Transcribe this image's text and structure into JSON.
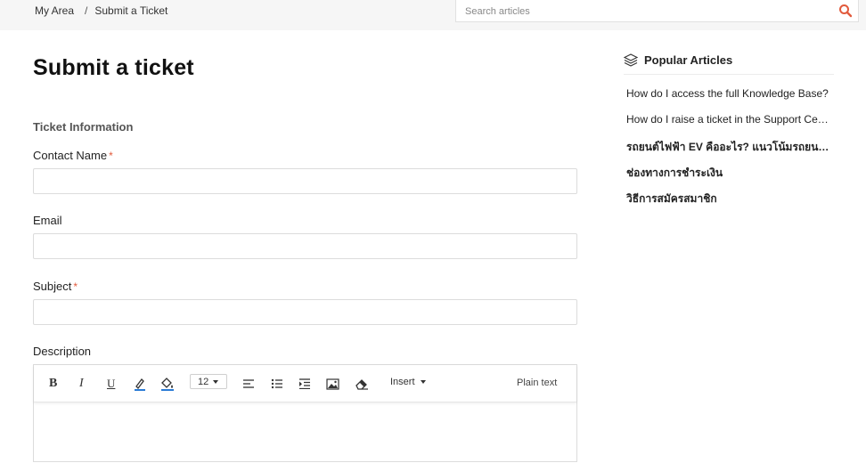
{
  "breadcrumb": {
    "items": [
      "My Area",
      "Submit a Ticket"
    ],
    "separator": "/"
  },
  "search": {
    "placeholder": "Search articles",
    "value": "",
    "icon": "search-icon"
  },
  "form": {
    "title": "Submit a ticket",
    "section_title": "Ticket Information",
    "fields": {
      "contact_name": {
        "label": "Contact Name",
        "required_mark": "*",
        "value": ""
      },
      "email": {
        "label": "Email",
        "value": ""
      },
      "subject": {
        "label": "Subject",
        "required_mark": "*",
        "value": ""
      },
      "description": {
        "label": "Description"
      }
    },
    "editor": {
      "bold": "B",
      "italic": "I",
      "underline": "U",
      "font_size": "12",
      "insert_label": "Insert",
      "plain_text_label": "Plain text"
    }
  },
  "sidebar": {
    "title": "Popular Articles",
    "icon": "layers-icon",
    "articles": [
      "How do I access the full Knowledge Base?",
      "How do I raise a ticket in the Support Center?",
      "รถยนต์ไฟฟ้า EV คืออะไร? แนวโน้มรถยนต์พลังงานไฟฟ้า",
      "ช่องทางการชำระเงิน",
      "วิธีการสมัครสมาชิก"
    ]
  },
  "colors": {
    "accent": "#e25a3c",
    "required": "#e25a3c",
    "topbar_bg": "#f6f6f6"
  }
}
